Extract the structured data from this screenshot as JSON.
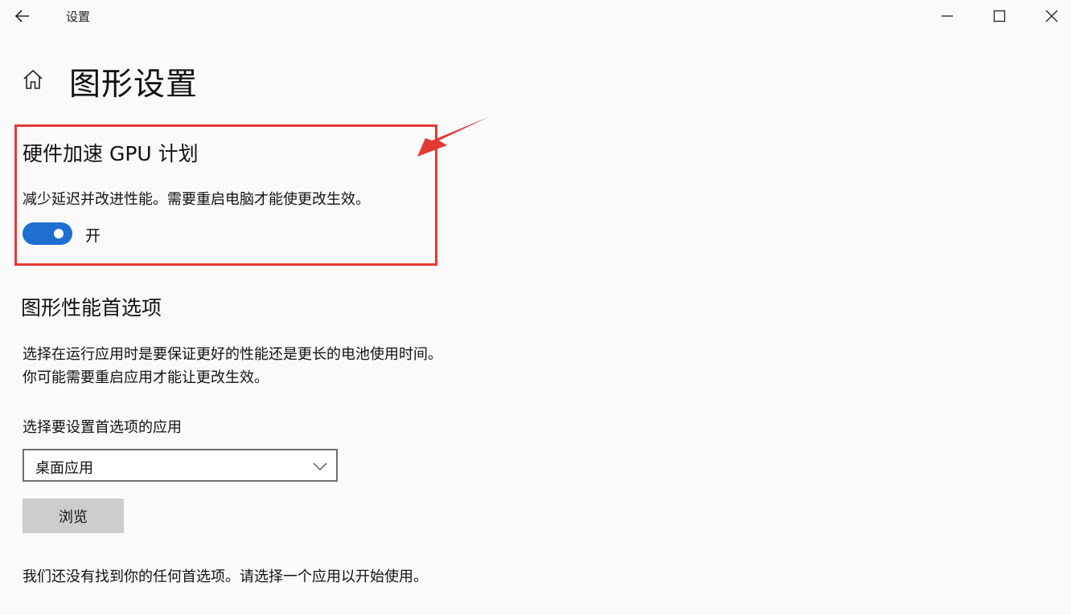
{
  "window": {
    "title": "设置",
    "controls": {
      "minimize_icon": "minimize-icon",
      "maximize_icon": "maximize-icon",
      "close_icon": "close-icon"
    }
  },
  "page": {
    "title": "图形设置"
  },
  "gpu_scheduling": {
    "title": "硬件加速 GPU 计划",
    "description": "减少延迟并改进性能。需要重启电脑才能使更改生效。",
    "toggle_state": "开",
    "toggle_on": true
  },
  "graphics_preference": {
    "title": "图形性能首选项",
    "description_line1": "选择在运行应用时是要保证更好的性能还是更长的电池使用时间。",
    "description_line2": "你可能需要重启应用才能让更改生效。",
    "select_label": "选择要设置首选项的应用",
    "select_value": "桌面应用",
    "browse_label": "浏览",
    "empty_message": "我们还没有找到你的任何首选项。请选择一个应用以开始使用。"
  },
  "colors": {
    "accent": "#1f6fd1",
    "highlight": "#e53935"
  }
}
